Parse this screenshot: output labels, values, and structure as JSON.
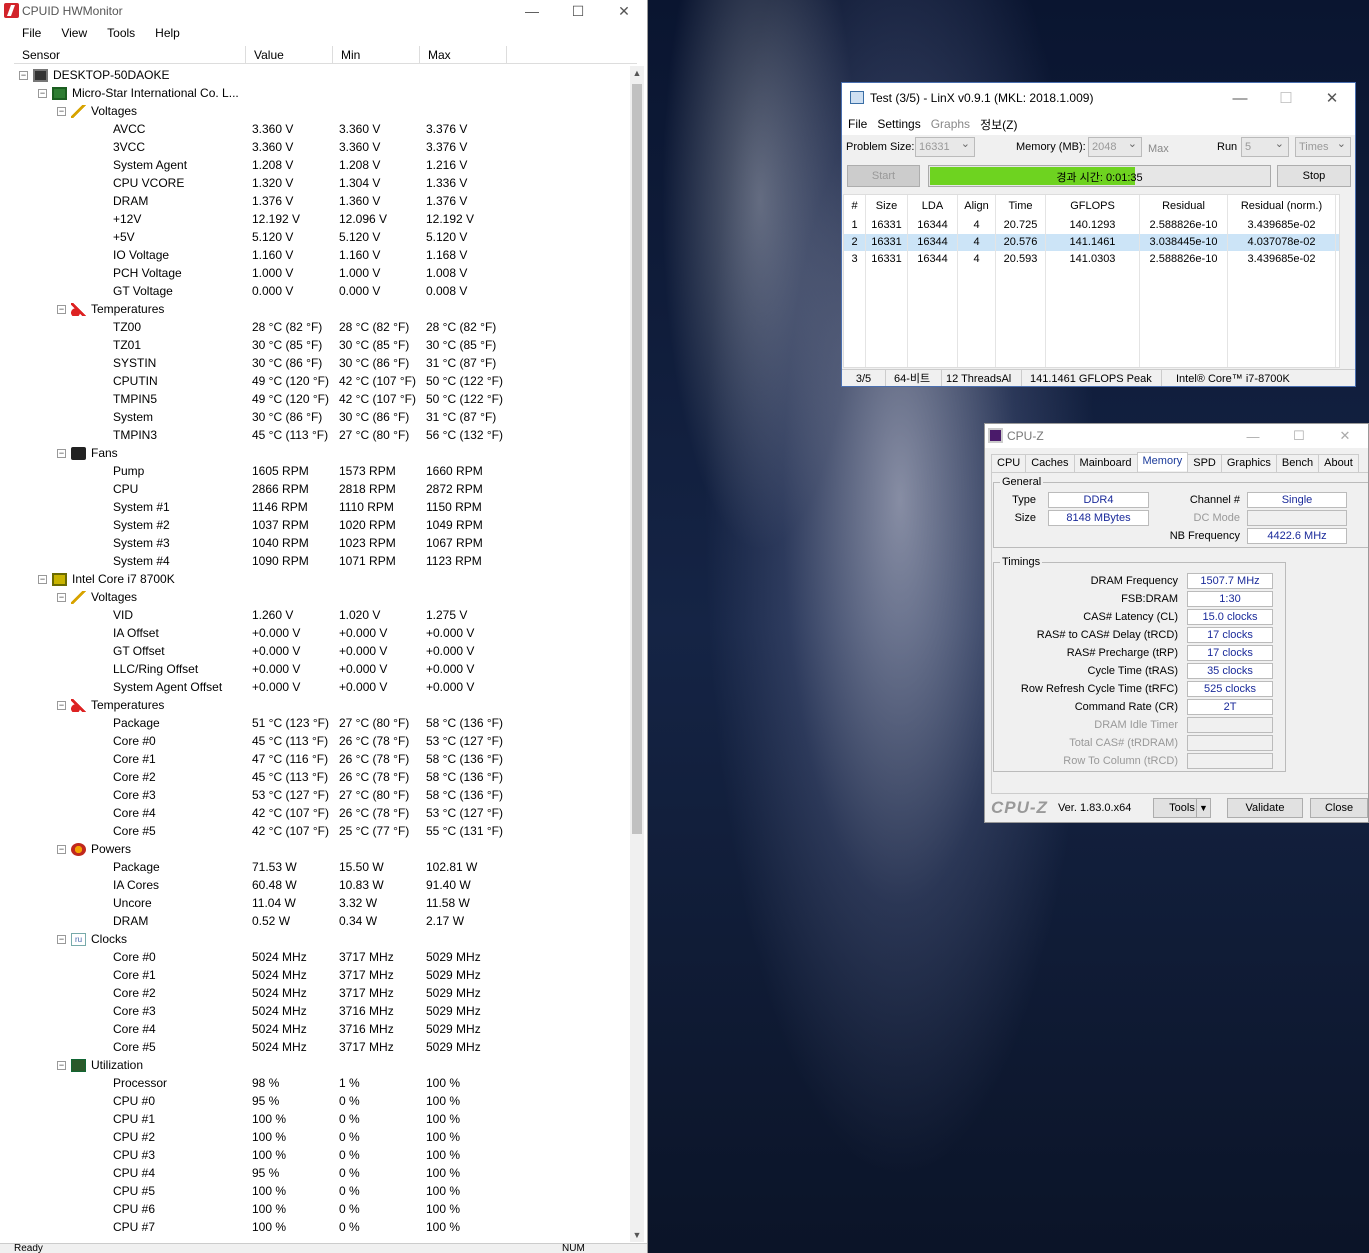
{
  "hwmonitor": {
    "title": "CPUID HWMonitor",
    "menu": [
      "File",
      "View",
      "Tools",
      "Help"
    ],
    "columns": [
      "Sensor",
      "Value",
      "Min",
      "Max"
    ],
    "status": "Ready",
    "status_right": "NUM",
    "tree": [
      {
        "k": "g",
        "level": 0,
        "icon": "pc",
        "label": "DESKTOP-50DAOKE"
      },
      {
        "k": "g",
        "level": 1,
        "icon": "mb",
        "label": "Micro-Star International Co. L..."
      },
      {
        "k": "g",
        "level": 2,
        "icon": "volt",
        "label": "Voltages"
      },
      {
        "k": "s",
        "label": "AVCC",
        "value": "3.360 V",
        "min": "3.360 V",
        "max": "3.376 V"
      },
      {
        "k": "s",
        "label": "3VCC",
        "value": "3.360 V",
        "min": "3.360 V",
        "max": "3.376 V"
      },
      {
        "k": "s",
        "label": "System Agent",
        "value": "1.208 V",
        "min": "1.208 V",
        "max": "1.216 V"
      },
      {
        "k": "s",
        "label": "CPU VCORE",
        "value": "1.320 V",
        "min": "1.304 V",
        "max": "1.336 V"
      },
      {
        "k": "s",
        "label": "DRAM",
        "value": "1.376 V",
        "min": "1.360 V",
        "max": "1.376 V"
      },
      {
        "k": "s",
        "label": "+12V",
        "value": "12.192 V",
        "min": "12.096 V",
        "max": "12.192 V"
      },
      {
        "k": "s",
        "label": "+5V",
        "value": "5.120 V",
        "min": "5.120 V",
        "max": "5.120 V"
      },
      {
        "k": "s",
        "label": "IO Voltage",
        "value": "1.160 V",
        "min": "1.160 V",
        "max": "1.168 V"
      },
      {
        "k": "s",
        "label": "PCH Voltage",
        "value": "1.000 V",
        "min": "1.000 V",
        "max": "1.008 V"
      },
      {
        "k": "s",
        "label": "GT Voltage",
        "value": "0.000 V",
        "min": "0.000 V",
        "max": "0.008 V"
      },
      {
        "k": "g",
        "level": 2,
        "icon": "temp",
        "label": "Temperatures"
      },
      {
        "k": "s",
        "label": "TZ00",
        "value": "28 °C  (82 °F)",
        "min": "28 °C  (82 °F)",
        "max": "28 °C  (82 °F)"
      },
      {
        "k": "s",
        "label": "TZ01",
        "value": "30 °C  (85 °F)",
        "min": "30 °C  (85 °F)",
        "max": "30 °C  (85 °F)"
      },
      {
        "k": "s",
        "label": "SYSTIN",
        "value": "30 °C  (86 °F)",
        "min": "30 °C  (86 °F)",
        "max": "31 °C  (87 °F)"
      },
      {
        "k": "s",
        "label": "CPUTIN",
        "value": "49 °C  (120 °F)",
        "min": "42 °C  (107 °F)",
        "max": "50 °C  (122 °F)"
      },
      {
        "k": "s",
        "label": "TMPIN5",
        "value": "49 °C  (120 °F)",
        "min": "42 °C  (107 °F)",
        "max": "50 °C  (122 °F)"
      },
      {
        "k": "s",
        "label": "System",
        "value": "30 °C  (86 °F)",
        "min": "30 °C  (86 °F)",
        "max": "31 °C  (87 °F)"
      },
      {
        "k": "s",
        "label": "TMPIN3",
        "value": "45 °C  (113 °F)",
        "min": "27 °C  (80 °F)",
        "max": "56 °C  (132 °F)"
      },
      {
        "k": "g",
        "level": 2,
        "icon": "fan",
        "label": "Fans"
      },
      {
        "k": "s",
        "label": "Pump",
        "value": "1605 RPM",
        "min": "1573 RPM",
        "max": "1660 RPM"
      },
      {
        "k": "s",
        "label": "CPU",
        "value": "2866 RPM",
        "min": "2818 RPM",
        "max": "2872 RPM"
      },
      {
        "k": "s",
        "label": "System #1",
        "value": "1146 RPM",
        "min": "1110 RPM",
        "max": "1150 RPM"
      },
      {
        "k": "s",
        "label": "System #2",
        "value": "1037 RPM",
        "min": "1020 RPM",
        "max": "1049 RPM"
      },
      {
        "k": "s",
        "label": "System #3",
        "value": "1040 RPM",
        "min": "1023 RPM",
        "max": "1067 RPM"
      },
      {
        "k": "s",
        "label": "System #4",
        "value": "1090 RPM",
        "min": "1071 RPM",
        "max": "1123 RPM"
      },
      {
        "k": "g",
        "level": 1,
        "icon": "cpu",
        "label": "Intel Core i7 8700K"
      },
      {
        "k": "g",
        "level": 2,
        "icon": "volt",
        "label": "Voltages"
      },
      {
        "k": "s",
        "label": "VID",
        "value": "1.260 V",
        "min": "1.020 V",
        "max": "1.275 V"
      },
      {
        "k": "s",
        "label": "IA Offset",
        "value": "+0.000 V",
        "min": "+0.000 V",
        "max": "+0.000 V"
      },
      {
        "k": "s",
        "label": "GT Offset",
        "value": "+0.000 V",
        "min": "+0.000 V",
        "max": "+0.000 V"
      },
      {
        "k": "s",
        "label": "LLC/Ring Offset",
        "value": "+0.000 V",
        "min": "+0.000 V",
        "max": "+0.000 V"
      },
      {
        "k": "s",
        "label": "System Agent Offset",
        "value": "+0.000 V",
        "min": "+0.000 V",
        "max": "+0.000 V"
      },
      {
        "k": "g",
        "level": 2,
        "icon": "temp",
        "label": "Temperatures"
      },
      {
        "k": "s",
        "label": "Package",
        "value": "51 °C  (123 °F)",
        "min": "27 °C  (80 °F)",
        "max": "58 °C  (136 °F)"
      },
      {
        "k": "s",
        "label": "Core #0",
        "value": "45 °C  (113 °F)",
        "min": "26 °C  (78 °F)",
        "max": "53 °C  (127 °F)"
      },
      {
        "k": "s",
        "label": "Core #1",
        "value": "47 °C  (116 °F)",
        "min": "26 °C  (78 °F)",
        "max": "58 °C  (136 °F)"
      },
      {
        "k": "s",
        "label": "Core #2",
        "value": "45 °C  (113 °F)",
        "min": "26 °C  (78 °F)",
        "max": "58 °C  (136 °F)"
      },
      {
        "k": "s",
        "label": "Core #3",
        "value": "53 °C  (127 °F)",
        "min": "27 °C  (80 °F)",
        "max": "58 °C  (136 °F)"
      },
      {
        "k": "s",
        "label": "Core #4",
        "value": "42 °C  (107 °F)",
        "min": "26 °C  (78 °F)",
        "max": "53 °C  (127 °F)"
      },
      {
        "k": "s",
        "label": "Core #5",
        "value": "42 °C  (107 °F)",
        "min": "25 °C  (77 °F)",
        "max": "55 °C  (131 °F)"
      },
      {
        "k": "g",
        "level": 2,
        "icon": "pow",
        "label": "Powers"
      },
      {
        "k": "s",
        "label": "Package",
        "value": "71.53 W",
        "min": "15.50 W",
        "max": "102.81 W"
      },
      {
        "k": "s",
        "label": "IA Cores",
        "value": "60.48 W",
        "min": "10.83 W",
        "max": "91.40 W"
      },
      {
        "k": "s",
        "label": "Uncore",
        "value": "11.04 W",
        "min": "3.32 W",
        "max": "11.58 W"
      },
      {
        "k": "s",
        "label": "DRAM",
        "value": "0.52 W",
        "min": "0.34 W",
        "max": "2.17 W"
      },
      {
        "k": "g",
        "level": 2,
        "icon": "clk",
        "label": "Clocks"
      },
      {
        "k": "s",
        "label": "Core #0",
        "value": "5024 MHz",
        "min": "3717 MHz",
        "max": "5029 MHz"
      },
      {
        "k": "s",
        "label": "Core #1",
        "value": "5024 MHz",
        "min": "3717 MHz",
        "max": "5029 MHz"
      },
      {
        "k": "s",
        "label": "Core #2",
        "value": "5024 MHz",
        "min": "3717 MHz",
        "max": "5029 MHz"
      },
      {
        "k": "s",
        "label": "Core #3",
        "value": "5024 MHz",
        "min": "3716 MHz",
        "max": "5029 MHz"
      },
      {
        "k": "s",
        "label": "Core #4",
        "value": "5024 MHz",
        "min": "3716 MHz",
        "max": "5029 MHz"
      },
      {
        "k": "s",
        "label": "Core #5",
        "value": "5024 MHz",
        "min": "3717 MHz",
        "max": "5029 MHz"
      },
      {
        "k": "g",
        "level": 2,
        "icon": "utl",
        "label": "Utilization"
      },
      {
        "k": "s",
        "label": "Processor",
        "value": "98 %",
        "min": "1 %",
        "max": "100 %"
      },
      {
        "k": "s",
        "label": "CPU #0",
        "value": "95 %",
        "min": "0 %",
        "max": "100 %"
      },
      {
        "k": "s",
        "label": "CPU #1",
        "value": "100 %",
        "min": "0 %",
        "max": "100 %"
      },
      {
        "k": "s",
        "label": "CPU #2",
        "value": "100 %",
        "min": "0 %",
        "max": "100 %"
      },
      {
        "k": "s",
        "label": "CPU #3",
        "value": "100 %",
        "min": "0 %",
        "max": "100 %"
      },
      {
        "k": "s",
        "label": "CPU #4",
        "value": "95 %",
        "min": "0 %",
        "max": "100 %"
      },
      {
        "k": "s",
        "label": "CPU #5",
        "value": "100 %",
        "min": "0 %",
        "max": "100 %"
      },
      {
        "k": "s",
        "label": "CPU #6",
        "value": "100 %",
        "min": "0 %",
        "max": "100 %"
      },
      {
        "k": "s",
        "label": "CPU #7",
        "value": "100 %",
        "min": "0 %",
        "max": "100 %"
      }
    ]
  },
  "linx": {
    "title": "Test (3/5) - LinX v0.9.1 (MKL: 2018.1.009)",
    "menu": [
      "File",
      "Settings",
      "Graphs",
      "정보(Z)"
    ],
    "problem_size_label": "Problem Size:",
    "problem_size": "16331",
    "memory_label": "Memory (MB):",
    "memory": "2048",
    "max_label": "Max",
    "run_label": "Run",
    "run": "5",
    "times": "Times",
    "start": "Start",
    "stop": "Stop",
    "elapsed": "경과 시간: 0:01:35",
    "progress": 0.6,
    "columns": [
      "#",
      "Size",
      "LDA",
      "Align",
      "Time",
      "GFLOPS",
      "Residual",
      "Residual (norm.)"
    ],
    "rows": [
      [
        "1",
        "16331",
        "16344",
        "4",
        "20.725",
        "140.1293",
        "2.588826e-10",
        "3.439685e-02"
      ],
      [
        "2",
        "16331",
        "16344",
        "4",
        "20.576",
        "141.1461",
        "3.038445e-10",
        "4.037078e-02"
      ],
      [
        "3",
        "16331",
        "16344",
        "4",
        "20.593",
        "141.0303",
        "2.588826e-10",
        "3.439685e-02"
      ]
    ],
    "selected_row": 1,
    "status": [
      "3/5",
      "64-비트",
      "12 ThreadsAl",
      "141.1461 GFLOPS Peak",
      "Intel® Core™ i7-8700K"
    ]
  },
  "cpuz": {
    "title": "CPU-Z",
    "tabs": [
      "CPU",
      "Caches",
      "Mainboard",
      "Memory",
      "SPD",
      "Graphics",
      "Bench",
      "About"
    ],
    "active_tab": "Memory",
    "general": {
      "legend": "General",
      "type_label": "Type",
      "type": "DDR4",
      "size_label": "Size",
      "size": "8148 MBytes",
      "channel_label": "Channel #",
      "channel": "Single",
      "dcmode_label": "DC Mode",
      "nbfreq_label": "NB Frequency",
      "nbfreq": "4422.6 MHz"
    },
    "timings": {
      "legend": "Timings",
      "items": [
        {
          "label": "DRAM Frequency",
          "value": "1507.7 MHz"
        },
        {
          "label": "FSB:DRAM",
          "value": "1:30"
        },
        {
          "label": "CAS# Latency (CL)",
          "value": "15.0 clocks"
        },
        {
          "label": "RAS# to CAS# Delay (tRCD)",
          "value": "17 clocks"
        },
        {
          "label": "RAS# Precharge (tRP)",
          "value": "17 clocks"
        },
        {
          "label": "Cycle Time (tRAS)",
          "value": "35 clocks"
        },
        {
          "label": "Row Refresh Cycle Time (tRFC)",
          "value": "525 clocks"
        },
        {
          "label": "Command Rate (CR)",
          "value": "2T"
        },
        {
          "label": "DRAM Idle Timer",
          "value": ""
        },
        {
          "label": "Total CAS# (tRDRAM)",
          "value": ""
        },
        {
          "label": "Row To Column (tRCD)",
          "value": ""
        }
      ]
    },
    "logo": "CPU-Z",
    "version": "Ver. 1.83.0.x64",
    "tools": "Tools",
    "validate": "Validate",
    "close": "Close"
  },
  "colors": {
    "progress": "#6ed320",
    "selected_row": "#cce4f7",
    "cpuz_value": "#1a2a9a"
  }
}
